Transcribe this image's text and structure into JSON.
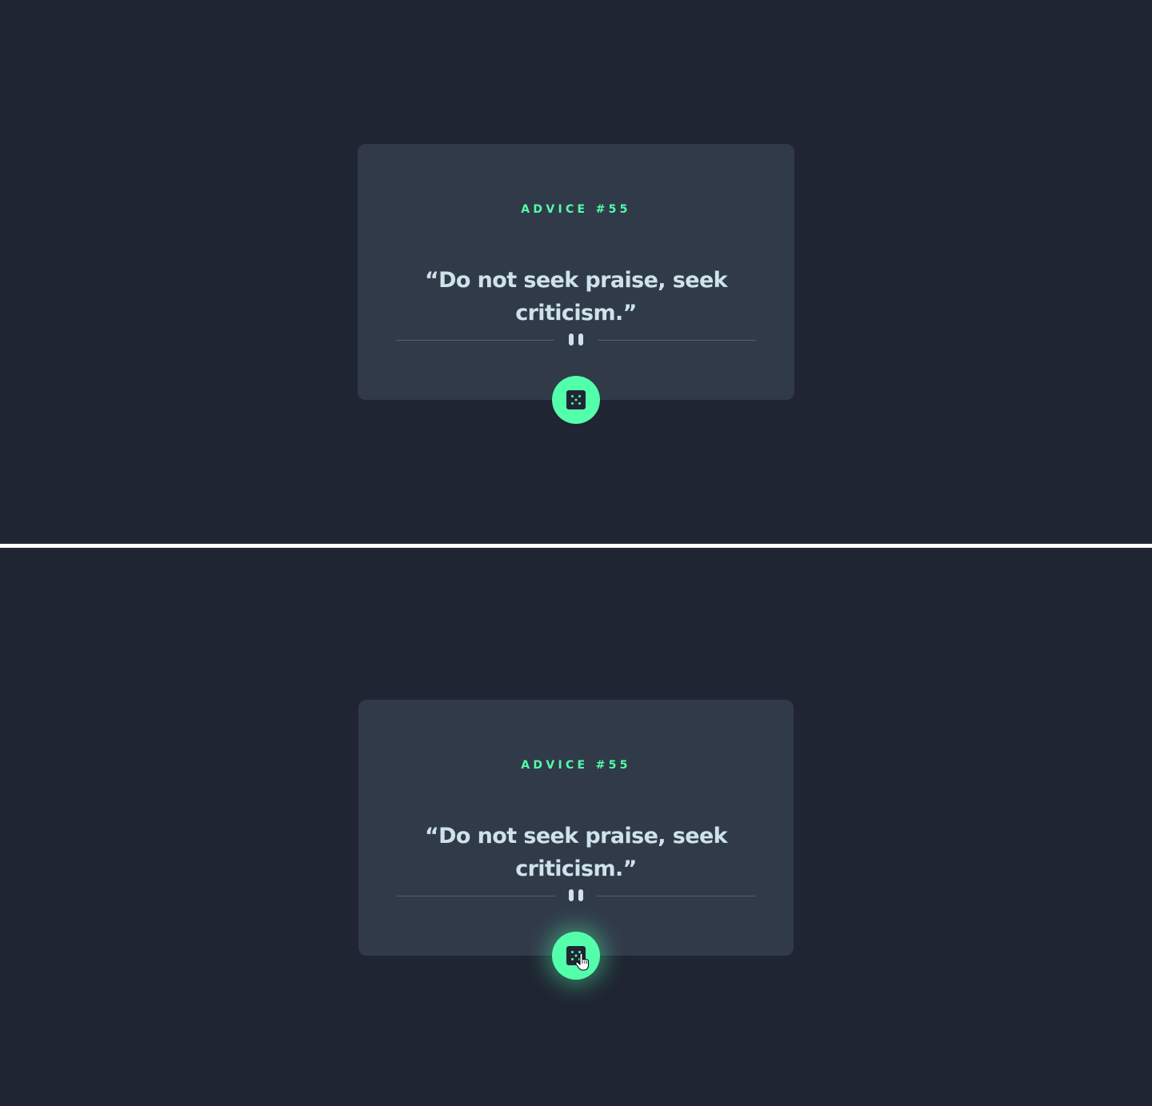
{
  "theme": {
    "background": "#1f2532",
    "card_background": "#313a49",
    "accent": "#53ffab",
    "text_light": "#cee3e9",
    "divider": "#4f5d74"
  },
  "states": [
    {
      "advice_label": "ADVICE #55",
      "quote": "“Do not seek praise, seek criticism.”",
      "button_icon": "dice-icon",
      "divider_icon": "pause-icon",
      "button_state": "default"
    },
    {
      "advice_label": "ADVICE #55",
      "quote": "“Do not seek praise, seek criticism.”",
      "button_icon": "dice-icon",
      "divider_icon": "pause-icon",
      "button_state": "hover",
      "cursor_icon": "hand-pointer-icon"
    }
  ]
}
